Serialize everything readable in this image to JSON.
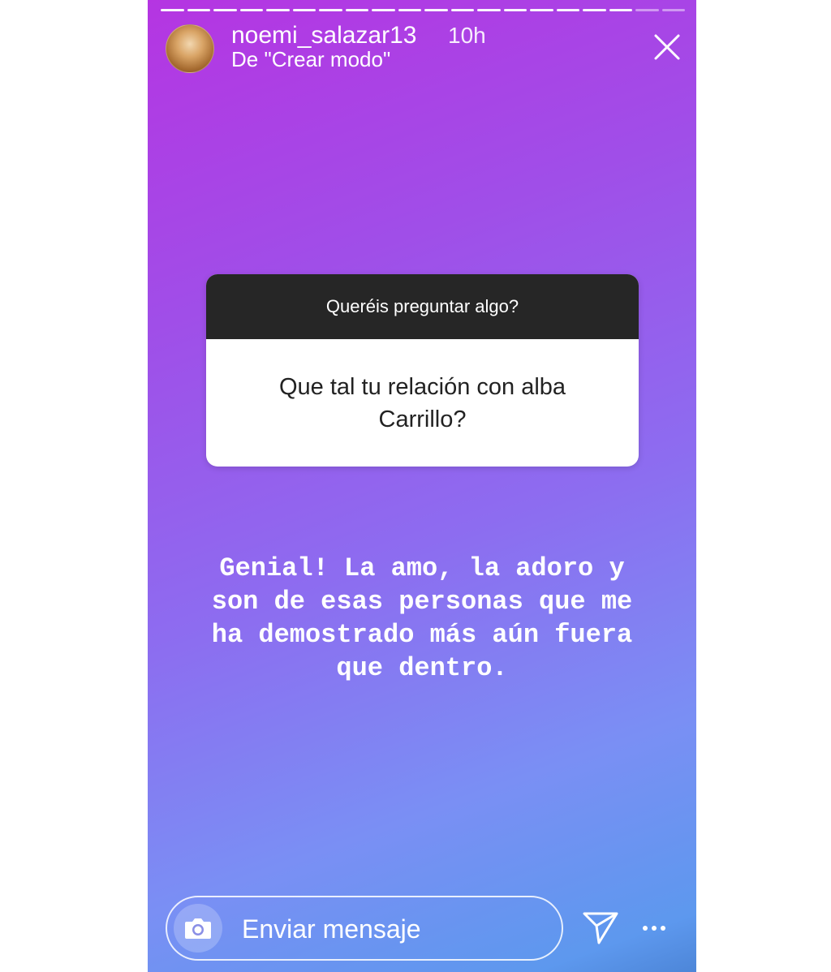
{
  "story": {
    "progress_segments": 20,
    "progress_viewed": 18
  },
  "header": {
    "username": "noemi_salazar13",
    "time": "10h",
    "subtitle": "De \"Crear modo\""
  },
  "question_card": {
    "prompt": "Queréis preguntar algo?",
    "question": "Que tal tu relación con alba Carrillo?"
  },
  "caption": {
    "text": "Genial! La amo, la adoro y\nson de esas personas que me\nha demostrado más aún fuera\nque dentro."
  },
  "footer": {
    "message_placeholder": "Enviar mensaje"
  },
  "icons": {
    "close": "close-icon",
    "camera": "camera-icon",
    "send": "send-icon",
    "more": "more-icon"
  }
}
